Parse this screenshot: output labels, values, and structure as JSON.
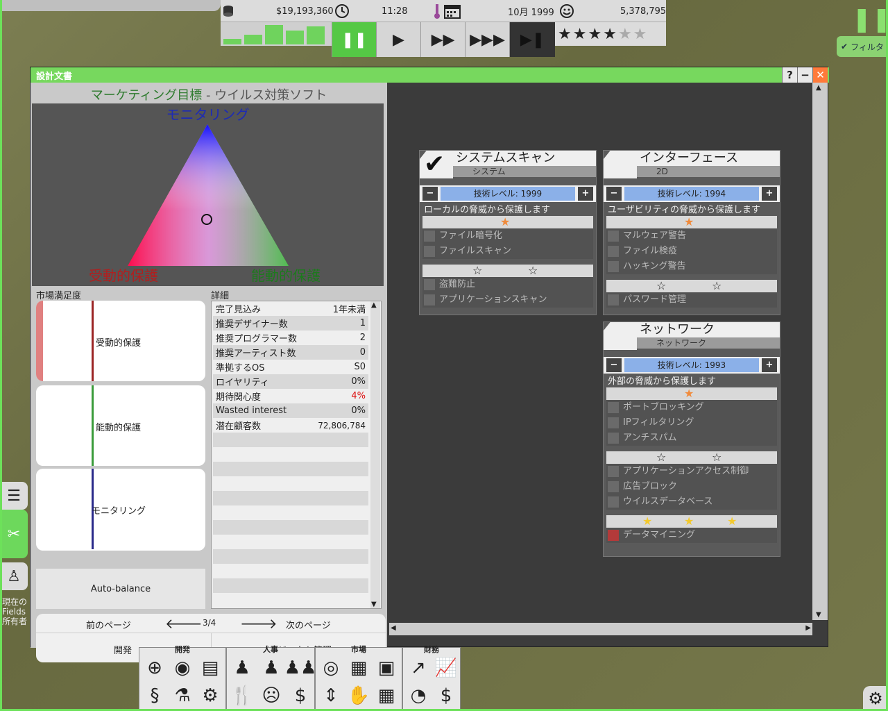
{
  "topbar": {
    "money": "$19,193,360",
    "time": "11:28",
    "date": "10月 1999",
    "followers": "5,378,795",
    "money_icon": "coins-icon",
    "clock_icon": "clock-icon",
    "thermo_icon": "thermometer-icon",
    "calendar_icon": "calendar-icon",
    "smile_icon": "smiley-icon",
    "stars_filled": 4,
    "stars_total": 6,
    "speed_buttons": [
      "pause",
      "play",
      "fast",
      "faster",
      "skip"
    ],
    "filter_label": "フィルタ",
    "fill_levels": [
      0.25,
      0.45,
      0.85,
      0.65,
      0.8
    ]
  },
  "window": {
    "title": "設計文書",
    "help": "?",
    "minimize": "−",
    "close": "✕"
  },
  "marketing": {
    "title_main": "マーケティング目標",
    "title_sep": " - ",
    "title_sub": "ウイルス対策ソフト",
    "top_label": "モニタリング",
    "left_label": "受動的保護",
    "right_label": "能動的保護",
    "satisfaction_label": "市場満足度",
    "details_label": "詳細",
    "sat_cards": [
      {
        "label": "受動的保護",
        "color": "#9b2525"
      },
      {
        "label": "能動的保護",
        "color": "#3a9b3a"
      },
      {
        "label": "モニタリング",
        "color": "#2a2a8a"
      }
    ],
    "auto_balance": "Auto-balance"
  },
  "details": [
    {
      "k": "完了見込み",
      "v": "1年未満"
    },
    {
      "k": "推奨デザイナー数",
      "v": "1"
    },
    {
      "k": "推奨プログラマー数",
      "v": "2"
    },
    {
      "k": "推奨アーティスト数",
      "v": "0"
    },
    {
      "k": "準拠するOS",
      "v": "S0"
    },
    {
      "k": "ロイヤリティ",
      "v": "0%"
    },
    {
      "k": "期待関心度",
      "v": "4%"
    },
    {
      "k": "Wasted interest",
      "v": "0%"
    },
    {
      "k": "潜在顧客数",
      "v": "72,806,784"
    }
  ],
  "nav": {
    "prev": "前のページ",
    "next": "次のページ",
    "page": "3/4",
    "develop": "開発",
    "project": "プロジェクト管理"
  },
  "features": {
    "system_scan": {
      "title": "システムスキャン",
      "sub": "システム",
      "tech": "技術レベル: 1999",
      "desc": "ローカルの脅威から保護します",
      "tier1": [
        "ファイル暗号化",
        "ファイルスキャン"
      ],
      "tier2": [
        "盗難防止",
        "アプリケーションスキャン"
      ]
    },
    "interface": {
      "title": "インターフェース",
      "sub": "2D",
      "tech": "技術レベル: 1994",
      "desc": "ユーザビリティの脅威から保護します",
      "tier1": [
        "マルウェア警告",
        "ファイル検疫",
        "ハッキング警告"
      ],
      "tier2": [
        "パスワード管理"
      ]
    },
    "network": {
      "title": "ネットワーク",
      "sub": "ネットワーク",
      "tech": "技術レベル: 1993",
      "desc": "外部の脅威から保護します",
      "tier1": [
        "ポートブロッキング",
        "IPフィルタリング",
        "アンチスパム"
      ],
      "tier2": [
        "アプリケーションアクセス制御",
        "広告ブロック",
        "ウイルスデータベース"
      ],
      "tier3": [
        "データマイニング"
      ]
    }
  },
  "toolbar": {
    "groups": [
      "開発",
      "人事",
      "市場",
      "財務"
    ]
  },
  "side": {
    "text1": "現在の",
    "text2": "Fields",
    "text3": "所有者"
  }
}
